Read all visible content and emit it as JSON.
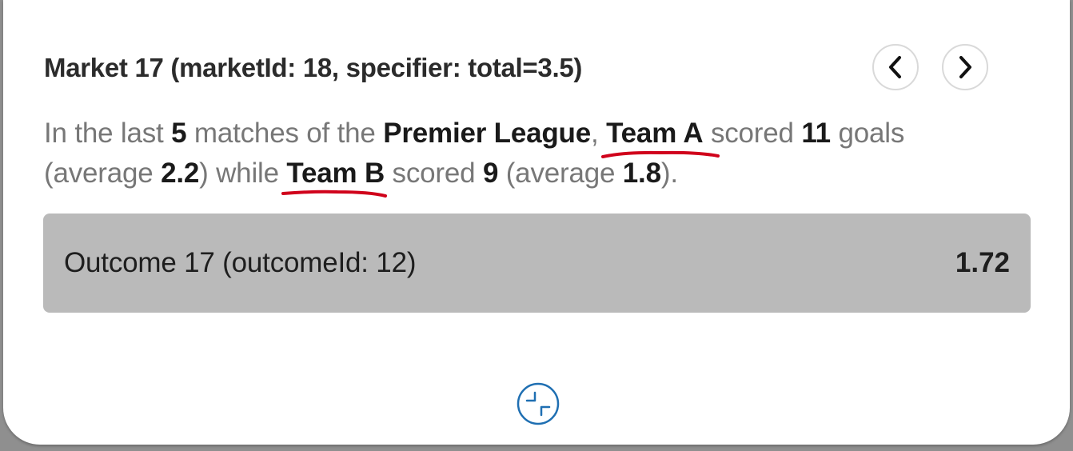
{
  "market": {
    "title": "Market 17 (marketId: 18, specifier: total=3.5)"
  },
  "summary": {
    "t1": "In the last ",
    "matches": "5",
    "t2": " matches of the ",
    "league": "Premier League",
    "t3": ", ",
    "team_a": "Team A",
    "t4": " scored ",
    "team_a_goals": "11",
    "t5": " goals (average ",
    "team_a_avg": "2.2",
    "t6": ") while ",
    "team_b": "Team B",
    "t7": " scored ",
    "team_b_goals": "9",
    "t8": " (average ",
    "team_b_avg": "1.8",
    "t9": ")."
  },
  "outcome": {
    "label": "Outcome 17 (outcomeId: 12)",
    "odds": "1.72"
  },
  "icons": {
    "prev": "chevron-left-icon",
    "next": "chevron-right-icon",
    "collapse": "collapse-icon"
  },
  "colors": {
    "outcome_bg": "#bababa",
    "underline": "#d0021b",
    "collapse_icon": "#1f6fb2"
  }
}
